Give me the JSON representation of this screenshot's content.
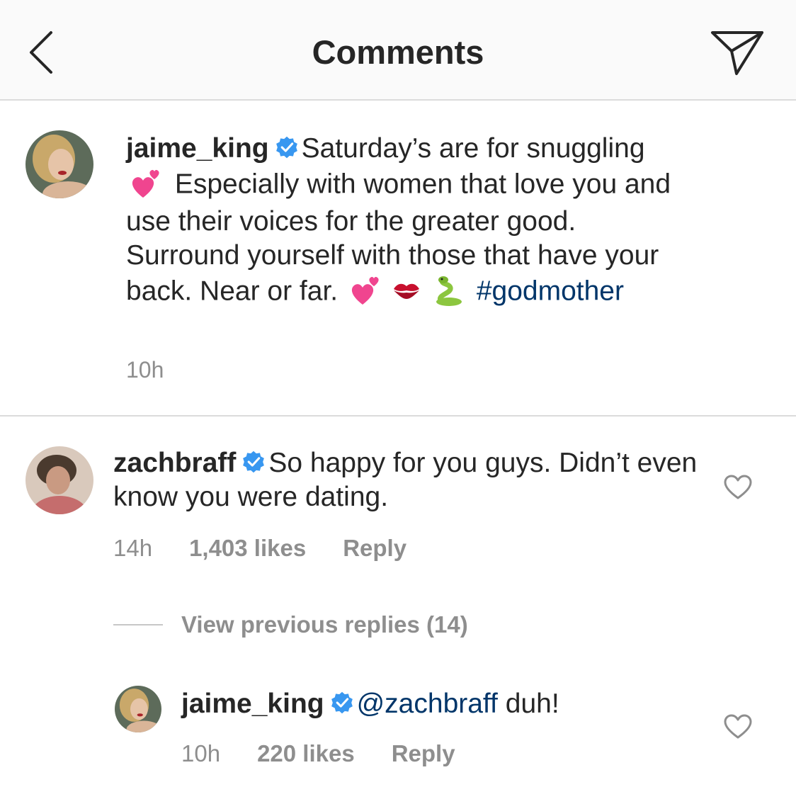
{
  "header": {
    "title": "Comments",
    "back_icon": "chevron-left-icon",
    "send_icon": "paper-plane-icon"
  },
  "caption": {
    "username": "jaime_king",
    "verified_icon": "verified-badge-icon",
    "text_1": "Saturday’s are for snuggling",
    "emoji_1": "two-hearts-emoji",
    "text_2": "Especially with women that love you and use their voices for the greater good. Surround yourself with those that have your back. Near or far.",
    "emoji_2": "two-hearts-emoji",
    "emoji_3": "kiss-mark-emoji",
    "emoji_4": "snake-emoji",
    "hashtag": "#godmother",
    "time": "10h"
  },
  "comment": {
    "username": "zachbraff",
    "text": "So happy for you guys. Didn’t even know you were dating.",
    "time": "14h",
    "likes": "1,403 likes",
    "reply_label": "Reply",
    "like_icon": "heart-outline-icon"
  },
  "view_replies": {
    "label": "View previous replies (14)"
  },
  "reply": {
    "username": "jaime_king",
    "mention": "@zachbraff",
    "text": "duh!",
    "time": "10h",
    "likes": "220 likes",
    "reply_label": "Reply",
    "like_icon": "heart-outline-icon"
  },
  "colors": {
    "text": "#262626",
    "secondary": "#8e8e8e",
    "link": "#003569",
    "verified": "#3897f0",
    "divider": "#dbdbdb"
  }
}
